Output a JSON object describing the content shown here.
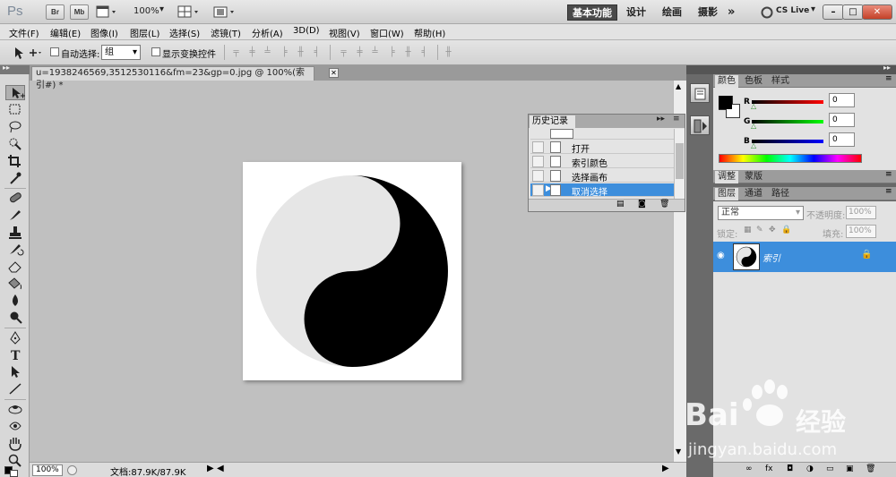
{
  "app": {
    "logo": "Ps",
    "bridge_label": "Br",
    "minibridge_label": "Mb",
    "zoom": "100%",
    "workspaces": [
      "基本功能",
      "设计",
      "绘画",
      "摄影"
    ],
    "more": "»",
    "cs_live": "CS Live",
    "window_buttons": [
      "–",
      "□",
      "✕"
    ]
  },
  "menu": [
    "文件(F)",
    "编辑(E)",
    "图像(I)",
    "图层(L)",
    "选择(S)",
    "滤镜(T)",
    "分析(A)",
    "3D(D)",
    "视图(V)",
    "窗口(W)",
    "帮助(H)"
  ],
  "options": {
    "auto_select_label": "自动选择:",
    "auto_select_value": "组",
    "show_transform_label": "显示变换控件"
  },
  "document": {
    "tab_title": "u=1938246569,3512530116&fm=23&gp=0.jpg @ 100%(索引#) *",
    "close": "✕",
    "zoom": "100%",
    "doc_info": "文档:87.9K/87.9K"
  },
  "history": {
    "tab": "历史记录",
    "items": [
      {
        "label": "打开",
        "selected": false
      },
      {
        "label": "索引颜色",
        "selected": false
      },
      {
        "label": "选择画布",
        "selected": false
      },
      {
        "label": "取消选择",
        "selected": true
      }
    ]
  },
  "color_panel": {
    "tabs": [
      "颜色",
      "色板",
      "样式"
    ],
    "r_label": "R",
    "r_value": "0",
    "g_label": "G",
    "g_value": "0",
    "b_label": "B",
    "b_value": "0",
    "foreground": "#000000",
    "background": "#ffffff"
  },
  "adjust_tabs": [
    "调整",
    "蒙版"
  ],
  "layers_panel": {
    "tabs": [
      "图层",
      "通道",
      "路径"
    ],
    "blend_mode": "正常",
    "opacity_label": "不透明度:",
    "opacity_value": "100%",
    "lock_label": "锁定:",
    "fill_label": "填充:",
    "fill_value": "100%",
    "layer_name": "索引"
  },
  "watermark": {
    "brand": "Bai",
    "brand_cn": "经验",
    "url": "jingyan.baidu.com"
  },
  "colors": {
    "selection": "#3d8edc",
    "accent": "#4a4a4a"
  }
}
